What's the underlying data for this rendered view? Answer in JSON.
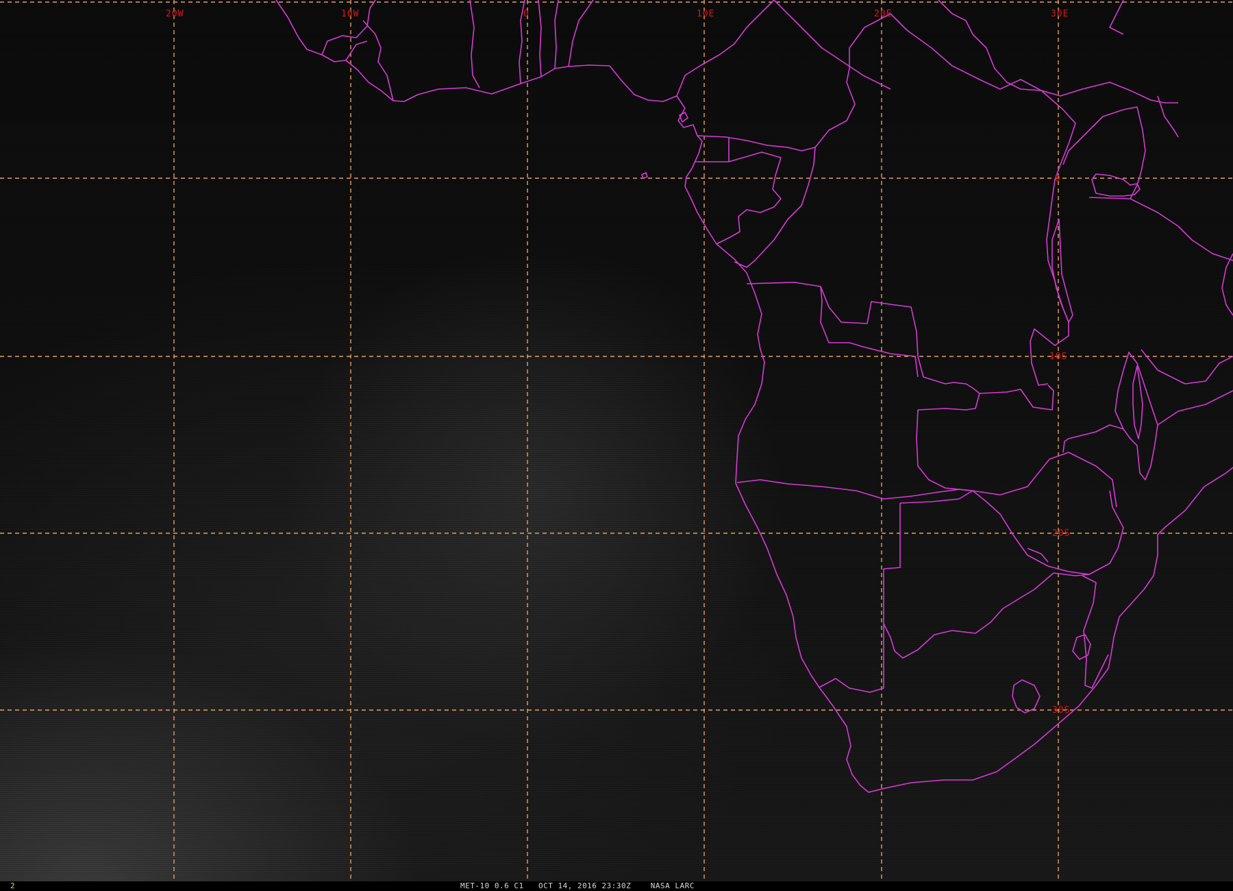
{
  "image": {
    "caption": "MET-10 0.6 C1   OCT 14, 2016 23:30Z    NASA LARC",
    "frame_number": "2"
  },
  "grid": {
    "longitude_labels": [
      "20W",
      "10W",
      "0",
      "10E",
      "20E",
      "30E"
    ],
    "latitude_labels": [
      "0",
      "10S",
      "20S",
      "30S"
    ]
  },
  "colors": {
    "coastline": "#d63bd6",
    "grid": "#e8a060",
    "grid_label": "#d81818",
    "caption": "#d8d8d8",
    "frame_number": "#e0e020"
  }
}
